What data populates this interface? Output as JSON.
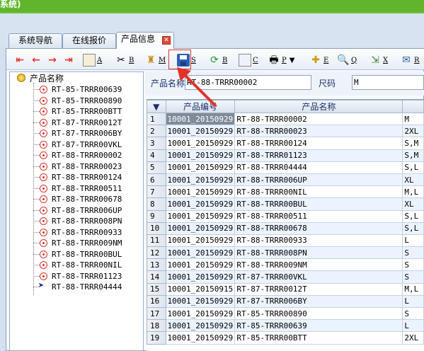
{
  "window": {
    "title_fragment": "系统)"
  },
  "tabs": [
    {
      "label": "系统导航",
      "active": false
    },
    {
      "label": "在线报价",
      "active": false
    },
    {
      "label": "产品信息",
      "active": true
    }
  ],
  "toolbar": {
    "keys": {
      "add": "A",
      "cut": "B",
      "paste": "M",
      "save": "S",
      "refresh": "B",
      "copy": "C",
      "print": "P",
      "edit": "E",
      "search": "Q",
      "export": "X",
      "mail": "R"
    },
    "print_menu": "▼"
  },
  "tree": {
    "root_label": "产品名称",
    "items": [
      "RT-85-TRRR00639",
      "RT-85-TRRR00890",
      "RT-85-TRRR00BTT",
      "RT-87-TRRR0012T",
      "RT-87-TRRR006BY",
      "RT-87-TRRR00VKL",
      "RT-88-TRRR00002",
      "RT-88-TRRR00023",
      "RT-88-TRRR00124",
      "RT-88-TRRR00511",
      "RT-88-TRRR00678",
      "RT-88-TRRR006UP",
      "RT-88-TRRR008PN",
      "RT-88-TRRR00933",
      "RT-88-TRRR009NM",
      "RT-88-TRRR00BUL",
      "RT-88-TRRR00NIL",
      "RT-88-TRRR01123",
      "RT-88-TRRR04444"
    ]
  },
  "filter": {
    "name_label": "产品名称",
    "name_value": "RT-88-TRRR00002",
    "size_label": "尺码",
    "size_value": "M"
  },
  "grid": {
    "columns": [
      "产品编号",
      "产品名称",
      ""
    ],
    "rows": [
      [
        "1",
        "10001_20150929",
        "RT-88-TRRR00002",
        "M"
      ],
      [
        "2",
        "10001_20150929",
        "RT-88-TRRR00023",
        "2XL"
      ],
      [
        "3",
        "10001_20150929",
        "RT-88-TRRR00124",
        "S,M"
      ],
      [
        "4",
        "10001_20150929",
        "RT-88-TRRR01123",
        "S,M"
      ],
      [
        "5",
        "10001_20150929",
        "RT-88-TRRR04444",
        "S,L"
      ],
      [
        "6",
        "10001_20150929",
        "RT-88-TRRR006UP",
        "XL"
      ],
      [
        "7",
        "10001_20150929",
        "RT-88-TRRR00NIL",
        "M,L"
      ],
      [
        "8",
        "10001_20150929",
        "RT-88-TRRR00BUL",
        "XL"
      ],
      [
        "9",
        "10001_20150929",
        "RT-88-TRRR00511",
        "S,L"
      ],
      [
        "10",
        "10001_20150929",
        "RT-88-TRRR00678",
        "S,L"
      ],
      [
        "11",
        "10001_20150929",
        "RT-88-TRRR00933",
        "L"
      ],
      [
        "12",
        "10001_20150929",
        "RT-88-TRRR008PN",
        "S"
      ],
      [
        "13",
        "10001_20150929",
        "RT-88-TRRR009NM",
        "S"
      ],
      [
        "14",
        "10001_20150929",
        "RT-87-TRRR00VKL",
        "S"
      ],
      [
        "15",
        "10001_20150915",
        "RT-87-TRRR0012T",
        "M,L"
      ],
      [
        "16",
        "10001_20150929",
        "RT-87-TRRR006BY",
        "L"
      ],
      [
        "17",
        "10001_20150929",
        "RT-85-TRRR00890",
        "S"
      ],
      [
        "18",
        "10001_20150929",
        "RT-85-TRRR00639",
        "L"
      ],
      [
        "19",
        "10001_20150929",
        "RT-85-TRRR00BTT",
        "2XL"
      ]
    ]
  },
  "colors": {
    "title_green": "#5fb52b",
    "callout_red": "#e0342a"
  }
}
